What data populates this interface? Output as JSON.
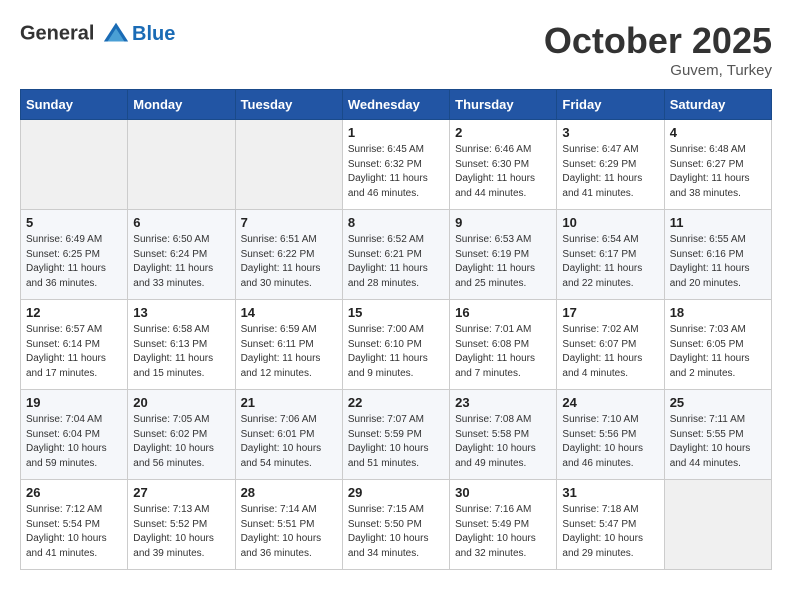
{
  "header": {
    "logo_line1": "General",
    "logo_line2": "Blue",
    "month_title": "October 2025",
    "subtitle": "Guvem, Turkey"
  },
  "days_of_week": [
    "Sunday",
    "Monday",
    "Tuesday",
    "Wednesday",
    "Thursday",
    "Friday",
    "Saturday"
  ],
  "weeks": [
    [
      {
        "num": "",
        "info": ""
      },
      {
        "num": "",
        "info": ""
      },
      {
        "num": "",
        "info": ""
      },
      {
        "num": "1",
        "info": "Sunrise: 6:45 AM\nSunset: 6:32 PM\nDaylight: 11 hours and 46 minutes."
      },
      {
        "num": "2",
        "info": "Sunrise: 6:46 AM\nSunset: 6:30 PM\nDaylight: 11 hours and 44 minutes."
      },
      {
        "num": "3",
        "info": "Sunrise: 6:47 AM\nSunset: 6:29 PM\nDaylight: 11 hours and 41 minutes."
      },
      {
        "num": "4",
        "info": "Sunrise: 6:48 AM\nSunset: 6:27 PM\nDaylight: 11 hours and 38 minutes."
      }
    ],
    [
      {
        "num": "5",
        "info": "Sunrise: 6:49 AM\nSunset: 6:25 PM\nDaylight: 11 hours and 36 minutes."
      },
      {
        "num": "6",
        "info": "Sunrise: 6:50 AM\nSunset: 6:24 PM\nDaylight: 11 hours and 33 minutes."
      },
      {
        "num": "7",
        "info": "Sunrise: 6:51 AM\nSunset: 6:22 PM\nDaylight: 11 hours and 30 minutes."
      },
      {
        "num": "8",
        "info": "Sunrise: 6:52 AM\nSunset: 6:21 PM\nDaylight: 11 hours and 28 minutes."
      },
      {
        "num": "9",
        "info": "Sunrise: 6:53 AM\nSunset: 6:19 PM\nDaylight: 11 hours and 25 minutes."
      },
      {
        "num": "10",
        "info": "Sunrise: 6:54 AM\nSunset: 6:17 PM\nDaylight: 11 hours and 22 minutes."
      },
      {
        "num": "11",
        "info": "Sunrise: 6:55 AM\nSunset: 6:16 PM\nDaylight: 11 hours and 20 minutes."
      }
    ],
    [
      {
        "num": "12",
        "info": "Sunrise: 6:57 AM\nSunset: 6:14 PM\nDaylight: 11 hours and 17 minutes."
      },
      {
        "num": "13",
        "info": "Sunrise: 6:58 AM\nSunset: 6:13 PM\nDaylight: 11 hours and 15 minutes."
      },
      {
        "num": "14",
        "info": "Sunrise: 6:59 AM\nSunset: 6:11 PM\nDaylight: 11 hours and 12 minutes."
      },
      {
        "num": "15",
        "info": "Sunrise: 7:00 AM\nSunset: 6:10 PM\nDaylight: 11 hours and 9 minutes."
      },
      {
        "num": "16",
        "info": "Sunrise: 7:01 AM\nSunset: 6:08 PM\nDaylight: 11 hours and 7 minutes."
      },
      {
        "num": "17",
        "info": "Sunrise: 7:02 AM\nSunset: 6:07 PM\nDaylight: 11 hours and 4 minutes."
      },
      {
        "num": "18",
        "info": "Sunrise: 7:03 AM\nSunset: 6:05 PM\nDaylight: 11 hours and 2 minutes."
      }
    ],
    [
      {
        "num": "19",
        "info": "Sunrise: 7:04 AM\nSunset: 6:04 PM\nDaylight: 10 hours and 59 minutes."
      },
      {
        "num": "20",
        "info": "Sunrise: 7:05 AM\nSunset: 6:02 PM\nDaylight: 10 hours and 56 minutes."
      },
      {
        "num": "21",
        "info": "Sunrise: 7:06 AM\nSunset: 6:01 PM\nDaylight: 10 hours and 54 minutes."
      },
      {
        "num": "22",
        "info": "Sunrise: 7:07 AM\nSunset: 5:59 PM\nDaylight: 10 hours and 51 minutes."
      },
      {
        "num": "23",
        "info": "Sunrise: 7:08 AM\nSunset: 5:58 PM\nDaylight: 10 hours and 49 minutes."
      },
      {
        "num": "24",
        "info": "Sunrise: 7:10 AM\nSunset: 5:56 PM\nDaylight: 10 hours and 46 minutes."
      },
      {
        "num": "25",
        "info": "Sunrise: 7:11 AM\nSunset: 5:55 PM\nDaylight: 10 hours and 44 minutes."
      }
    ],
    [
      {
        "num": "26",
        "info": "Sunrise: 7:12 AM\nSunset: 5:54 PM\nDaylight: 10 hours and 41 minutes."
      },
      {
        "num": "27",
        "info": "Sunrise: 7:13 AM\nSunset: 5:52 PM\nDaylight: 10 hours and 39 minutes."
      },
      {
        "num": "28",
        "info": "Sunrise: 7:14 AM\nSunset: 5:51 PM\nDaylight: 10 hours and 36 minutes."
      },
      {
        "num": "29",
        "info": "Sunrise: 7:15 AM\nSunset: 5:50 PM\nDaylight: 10 hours and 34 minutes."
      },
      {
        "num": "30",
        "info": "Sunrise: 7:16 AM\nSunset: 5:49 PM\nDaylight: 10 hours and 32 minutes."
      },
      {
        "num": "31",
        "info": "Sunrise: 7:18 AM\nSunset: 5:47 PM\nDaylight: 10 hours and 29 minutes."
      },
      {
        "num": "",
        "info": ""
      }
    ]
  ]
}
